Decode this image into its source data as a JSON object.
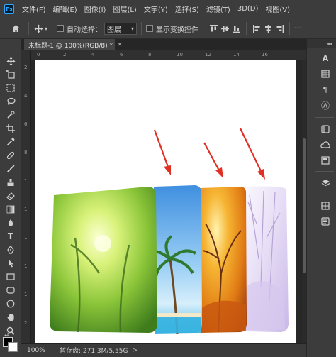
{
  "app": {
    "logo": "Ps"
  },
  "menu": [
    "文件(F)",
    "编辑(E)",
    "图像(I)",
    "图层(L)",
    "文字(Y)",
    "选择(S)",
    "滤镜(T)",
    "3D(D)",
    "视图(V)"
  ],
  "options": {
    "home_icon": "home-icon",
    "move_icon": "move-tool-icon",
    "auto_select_label": "自动选择：",
    "auto_select_target": "图层",
    "show_transform_label": "显示变换控件",
    "align_icons": [
      "align-top-icon",
      "align-vertical-center-icon",
      "align-bottom-icon",
      "align-left-icon",
      "align-horizontal-center-icon",
      "align-right-icon"
    ],
    "more_label": "···"
  },
  "document": {
    "tab_title": "未标题-1 @ 100%(RGB/8) *",
    "close_symbol": "×"
  },
  "rulers": {
    "top": [
      "0",
      "2",
      "4",
      "6",
      "8",
      "10",
      "12",
      "14",
      "16"
    ],
    "left": [
      "2",
      "4",
      "6",
      "8",
      "1",
      "1",
      "1",
      "1",
      "1",
      "2"
    ]
  },
  "status": {
    "zoom": "100%",
    "scratch_disk": "暂存盘: 271.3M/5.55G",
    "arrow": ">"
  },
  "tools": [
    "move-tool-icon",
    "artboard-tool-icon",
    "marquee-tool-icon",
    "lasso-tool-icon",
    "quick-select-tool-icon",
    "crop-tool-icon",
    "eyedropper-tool-icon",
    "healing-brush-icon",
    "brush-tool-icon",
    "stamp-tool-icon",
    "history-brush-icon",
    "eraser-tool-icon",
    "gradient-tool-icon",
    "blur-tool-icon",
    "dodge-tool-icon",
    "pen-tool-icon",
    "type-tool-icon",
    "path-select-icon",
    "rectangle-tool-icon",
    "hand-tool-icon",
    "zoom-tool-icon"
  ],
  "right_panels": [
    "character-panel-icon",
    "paragraph-panel-icon",
    "glyphs-panel-icon",
    "color-panel-icon",
    "swatches-panel-icon",
    "libraries-panel-icon",
    "adjustments-panel-icon",
    "layers-panel-icon",
    "channels-panel-icon",
    "paths-panel-icon"
  ],
  "colors": {
    "chrome": "#3c3c3c",
    "canvas_bg": "#ffffff",
    "arrow_red": "#e03024",
    "ps_blue": "#31a8ff"
  },
  "artwork": {
    "panels": [
      "spring-forest-panel",
      "summer-beach-panel",
      "autumn-tree-panel",
      "winter-snow-panel"
    ],
    "arrows": 3
  }
}
